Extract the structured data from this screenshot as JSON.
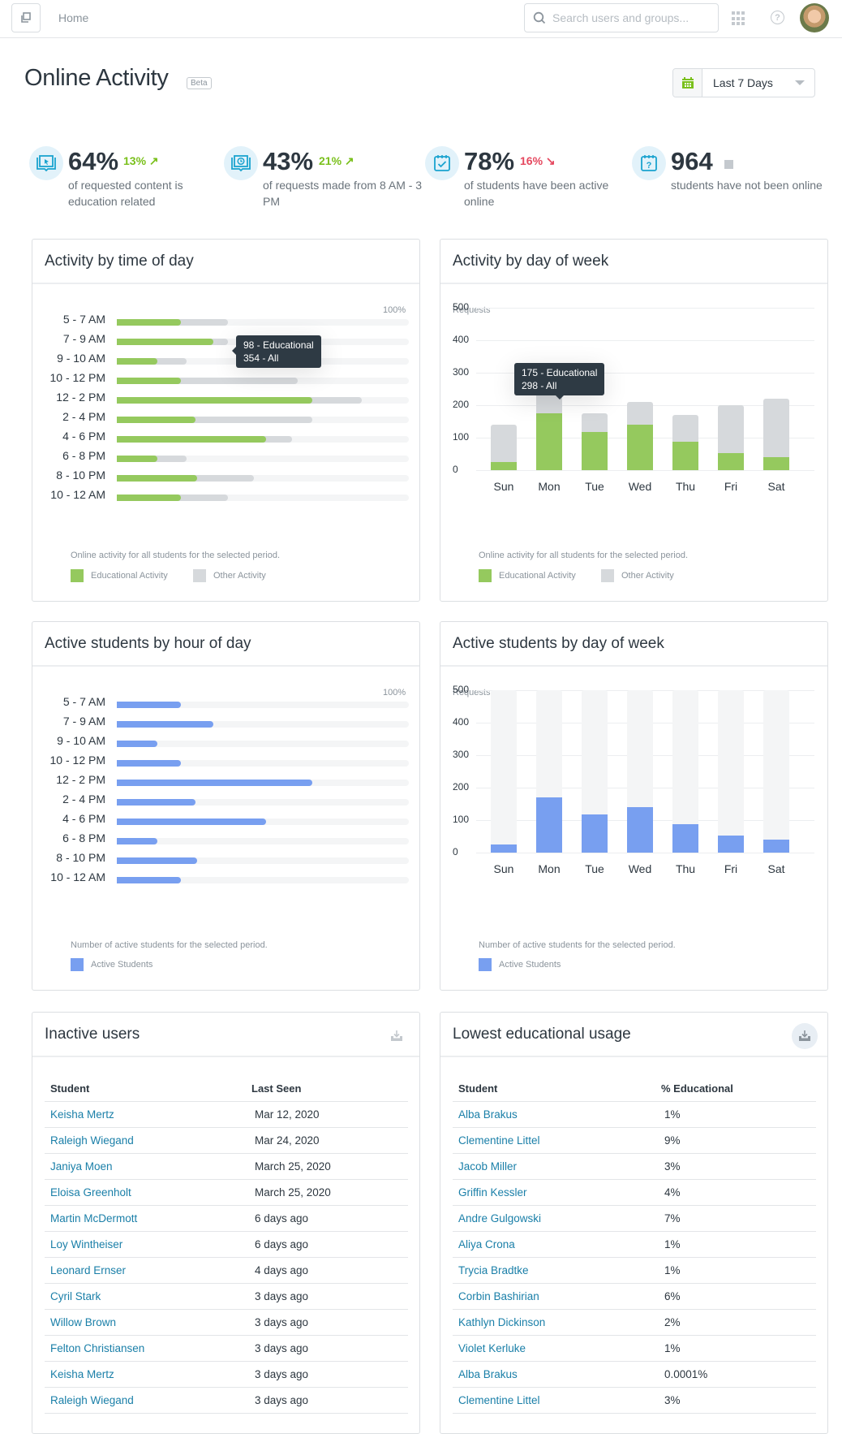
{
  "nav": {
    "home_label": "Home",
    "search_placeholder": "Search users and groups...",
    "icons": [
      "window-toggle-icon",
      "apps-grid-icon",
      "help-icon",
      "user-avatar"
    ]
  },
  "header": {
    "title": "Online Activity",
    "badge": "Beta",
    "date_range": "Last 7 Days",
    "date_icon": "calendar-icon"
  },
  "stats": [
    {
      "icon": "book-cursor-icon",
      "value": "64%",
      "delta": "13%",
      "trend": "up",
      "description": "of requested content is education related"
    },
    {
      "icon": "book-clock-icon",
      "value": "43%",
      "delta": "21%",
      "trend": "up",
      "description": "of requests made from 8 AM - 3 PM"
    },
    {
      "icon": "calendar-check-icon",
      "value": "78%",
      "delta": "16%",
      "trend": "down",
      "description": "of students have been active online"
    },
    {
      "icon": "calendar-question-icon",
      "value": "964",
      "delta": "",
      "trend": "neutral",
      "description": "students have not been online"
    }
  ],
  "colors": {
    "educational": "#95c95e",
    "other": "#d6d9dc",
    "active_students": "#789ff0",
    "track": "#f4f5f6",
    "link": "#1a7fa8",
    "up": "#7ac01c",
    "down": "#e5485f",
    "icon_accent": "#1aa3cf"
  },
  "cards": {
    "activity_time": {
      "title": "Activity by time of day",
      "scale_label": "100%",
      "note": "Online activity for all students for the selected period.",
      "legend": [
        "Educational Activity",
        "Other Activity"
      ],
      "tooltip": {
        "line1": "98 - Educational",
        "line2": "354 - All",
        "row_index": 1
      }
    },
    "activity_week": {
      "title": "Activity by day of week",
      "axis_label": "Requests",
      "note": "Online activity for all students for the selected period.",
      "legend": [
        "Educational Activity",
        "Other Activity"
      ],
      "tooltip": {
        "line1": "175 - Educational",
        "line2": "298 - All",
        "bar_index": 1
      }
    },
    "students_hour": {
      "title": "Active students by hour of day",
      "scale_label": "100%",
      "note": "Number of active students for the selected period.",
      "legend": [
        "Active Students"
      ]
    },
    "students_week": {
      "title": "Active students by day of week",
      "axis_label": "Requests",
      "note": "Number of active students for the selected period.",
      "legend": [
        "Active Students"
      ]
    },
    "inactive": {
      "title": "Inactive users",
      "columns": [
        "Student",
        "Last Seen"
      ],
      "rows": [
        [
          "Keisha Mertz",
          "Mar 12, 2020"
        ],
        [
          "Raleigh Wiegand",
          "Mar 24, 2020"
        ],
        [
          "Janiya Moen",
          "March 25, 2020"
        ],
        [
          "Eloisa Greenholt",
          "March 25, 2020"
        ],
        [
          "Martin McDermott",
          "6 days ago"
        ],
        [
          "Loy Wintheiser",
          "6 days ago"
        ],
        [
          "Leonard Ernser",
          "4 days ago"
        ],
        [
          "Cyril Stark",
          "3 days ago"
        ],
        [
          "Willow Brown",
          "3 days ago"
        ],
        [
          "Felton Christiansen",
          "3 days ago"
        ],
        [
          "Keisha Mertz",
          "3 days ago"
        ],
        [
          "Raleigh Wiegand",
          "3 days ago"
        ]
      ]
    },
    "lowest": {
      "title": "Lowest educational usage",
      "columns": [
        "Student",
        "% Educational"
      ],
      "rows": [
        [
          "Alba Brakus",
          "1%"
        ],
        [
          "Clementine Littel",
          "9%"
        ],
        [
          "Jacob Miller",
          "3%"
        ],
        [
          "Griffin Kessler",
          "4%"
        ],
        [
          "Andre Gulgowski",
          "7%"
        ],
        [
          "Aliya Crona",
          "1%"
        ],
        [
          "Trycia Bradtke",
          "1%"
        ],
        [
          "Corbin Bashirian",
          "6%"
        ],
        [
          "Kathlyn Dickinson",
          "2%"
        ],
        [
          "Violet Kerluke",
          "1%"
        ],
        [
          "Alba Brakus",
          "0.0001%"
        ],
        [
          "Clementine Littel",
          "3%"
        ]
      ]
    }
  },
  "chart_data": [
    {
      "type": "bar",
      "orientation": "horizontal",
      "title": "Activity by time of day",
      "categories": [
        "5 - 7 AM",
        "7 - 9 AM",
        "9 - 10 AM",
        "10 - 12 PM",
        "12 - 2 PM",
        "2 - 4 PM",
        "4 - 6 PM",
        "6 - 8 PM",
        "8 - 10 PM",
        "10 - 12 AM"
      ],
      "series": [
        {
          "name": "Educational Activity",
          "values": [
            22,
            33,
            14,
            22,
            67,
            27,
            51,
            14,
            27.5,
            22
          ]
        },
        {
          "name": "All Activity",
          "values": [
            38,
            38,
            24,
            62,
            84,
            67,
            60,
            24,
            47,
            38
          ]
        }
      ],
      "unit": "%",
      "xlim": [
        0,
        100
      ],
      "legend": "bottom-left"
    },
    {
      "type": "bar",
      "orientation": "vertical",
      "stacked": "overlay",
      "title": "Activity by day of week",
      "categories": [
        "Sun",
        "Mon",
        "Tue",
        "Wed",
        "Thu",
        "Fri",
        "Sat"
      ],
      "series": [
        {
          "name": "Educational Activity",
          "values": [
            25,
            175,
            117,
            140,
            87,
            52,
            40
          ]
        },
        {
          "name": "All Activity",
          "values": [
            139,
            298,
            175,
            210,
            170,
            200,
            220
          ]
        }
      ],
      "ylabel": "Requests",
      "yticks": [
        0,
        100,
        200,
        300,
        400,
        500
      ],
      "ylim": [
        0,
        500
      ],
      "grid": true,
      "legend": "bottom-left"
    },
    {
      "type": "bar",
      "orientation": "horizontal",
      "title": "Active students by hour of day",
      "categories": [
        "5 - 7 AM",
        "7 - 9 AM",
        "9 - 10 AM",
        "10 - 12 PM",
        "12 - 2 PM",
        "2 - 4 PM",
        "4 - 6 PM",
        "6 - 8 PM",
        "8 - 10 PM",
        "10 - 12 AM"
      ],
      "series": [
        {
          "name": "Active Students",
          "values": [
            22,
            33,
            14,
            22,
            67,
            27,
            51,
            14,
            27.5,
            22
          ]
        }
      ],
      "unit": "%",
      "xlim": [
        0,
        100
      ],
      "legend": "bottom-left"
    },
    {
      "type": "bar",
      "orientation": "vertical",
      "title": "Active students by day of week",
      "categories": [
        "Sun",
        "Mon",
        "Tue",
        "Wed",
        "Thu",
        "Fri",
        "Sat"
      ],
      "series": [
        {
          "name": "Active Students",
          "values": [
            25,
            170,
            117,
            140,
            87,
            52,
            40
          ]
        }
      ],
      "ylabel": "Requests",
      "yticks": [
        0,
        100,
        200,
        300,
        400,
        500
      ],
      "ylim": [
        0,
        500
      ],
      "grid": true,
      "legend": "bottom-left"
    }
  ]
}
